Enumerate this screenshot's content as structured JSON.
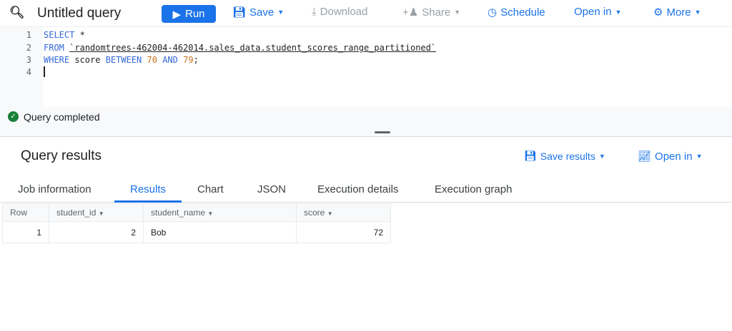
{
  "toolbar": {
    "title": "Untitled query",
    "run": "Run",
    "save": "Save",
    "download": "Download",
    "share": "Share",
    "schedule": "Schedule",
    "open_in": "Open in",
    "more": "More"
  },
  "editor": {
    "line_numbers": [
      "1",
      "2",
      "3",
      "4"
    ],
    "l1_kw": "SELECT",
    "l1_rest": " *",
    "l2_kw": "FROM",
    "l2_table": "`randomtrees-462004-462014.sales_data.student_scores_range_partitioned`",
    "l3_kw": "WHERE",
    "l3_col": " score ",
    "l3_between": "BETWEEN",
    "l3_n1": "70",
    "l3_and": "AND",
    "l3_n2": "79",
    "l3_end": ";"
  },
  "status": {
    "text": "Query completed",
    "color": "#188038"
  },
  "results": {
    "title": "Query results",
    "save_results": "Save results",
    "open_in": "Open in",
    "tabs": [
      "Job information",
      "Results",
      "Chart",
      "JSON",
      "Execution details",
      "Execution graph"
    ],
    "active_tab": "Results",
    "columns": [
      "Row",
      "student_id",
      "student_name",
      "score"
    ],
    "rows": [
      [
        "1",
        "2",
        "Bob",
        "72"
      ]
    ]
  }
}
